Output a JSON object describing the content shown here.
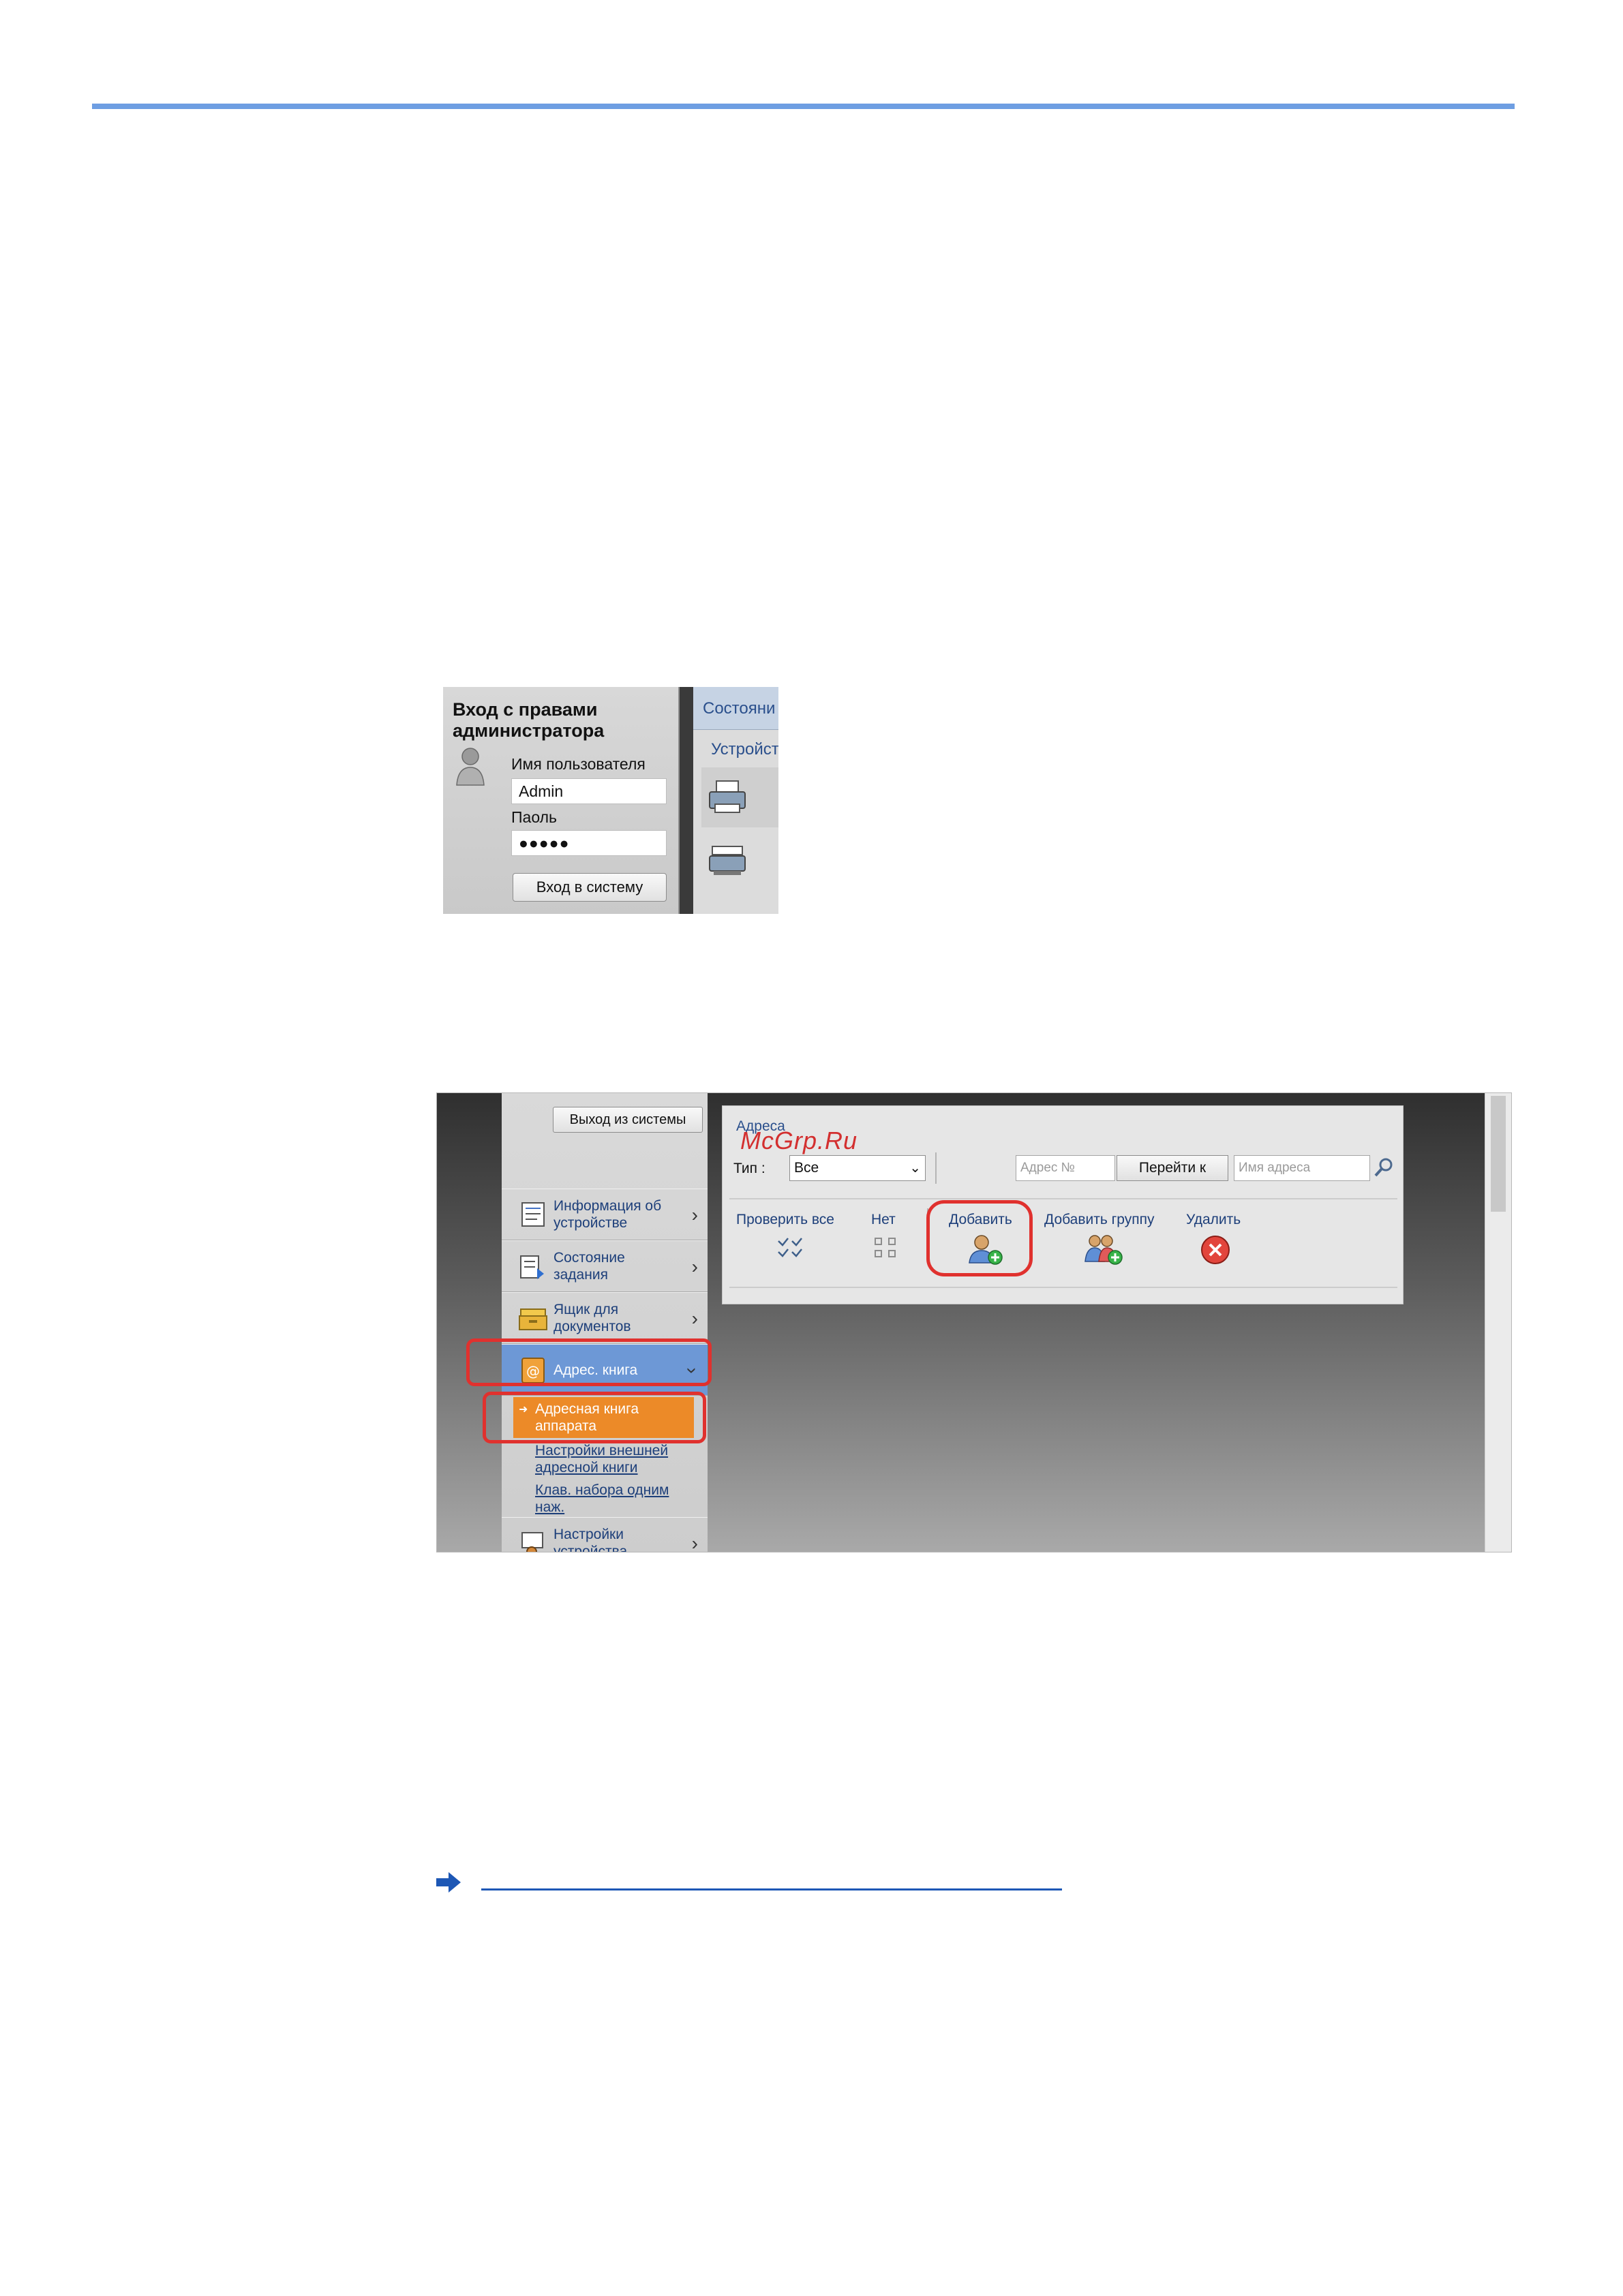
{
  "login": {
    "title": "Вход с правами администратора",
    "username_label": "Имя пользователя",
    "username_value": "Admin",
    "password_label": "Паоль",
    "password_value": "●●●●●",
    "login_button": "Вход в систему",
    "tab_partial": "Состояни",
    "subtab_partial": "Устройст",
    "icons": [
      "avatar-icon",
      "printer-icon",
      "scanner-icon"
    ]
  },
  "address_book": {
    "logout_button": "Выход из системы",
    "menu": [
      {
        "label": "Информация об устройстве",
        "icon": "device-info-icon"
      },
      {
        "label": "Состояние задания",
        "icon": "job-status-icon"
      },
      {
        "label": "Ящик для документов",
        "icon": "document-box-icon"
      },
      {
        "label": "Адрес. книга",
        "icon": "address-book-icon"
      },
      {
        "label": "Настройки устройства",
        "icon": "device-settings-icon"
      }
    ],
    "submenu": {
      "active": "Адресная книга аппарата",
      "links": [
        "Настройки внешней адресной книги",
        "Клав. набора одним наж."
      ]
    },
    "panel": {
      "heading": "Адреса",
      "watermark": "McGrp.Ru",
      "type_label": "Тип :",
      "type_value": "Все",
      "address_no_placeholder": "Адрес №",
      "go_button": "Перейти к",
      "address_name_placeholder": "Имя адреса",
      "actions": {
        "check_all": "Проверить все",
        "none": "Нет",
        "add": "Добавить",
        "add_group": "Добавить группу",
        "delete": "Удалить"
      }
    },
    "highlight_color": "#e0312e",
    "active_menu_color": "#6d98d6",
    "active_submenu_color": "#ec8a28"
  },
  "accent_color": "#6e9ee2",
  "link_color": "#1d57b5"
}
